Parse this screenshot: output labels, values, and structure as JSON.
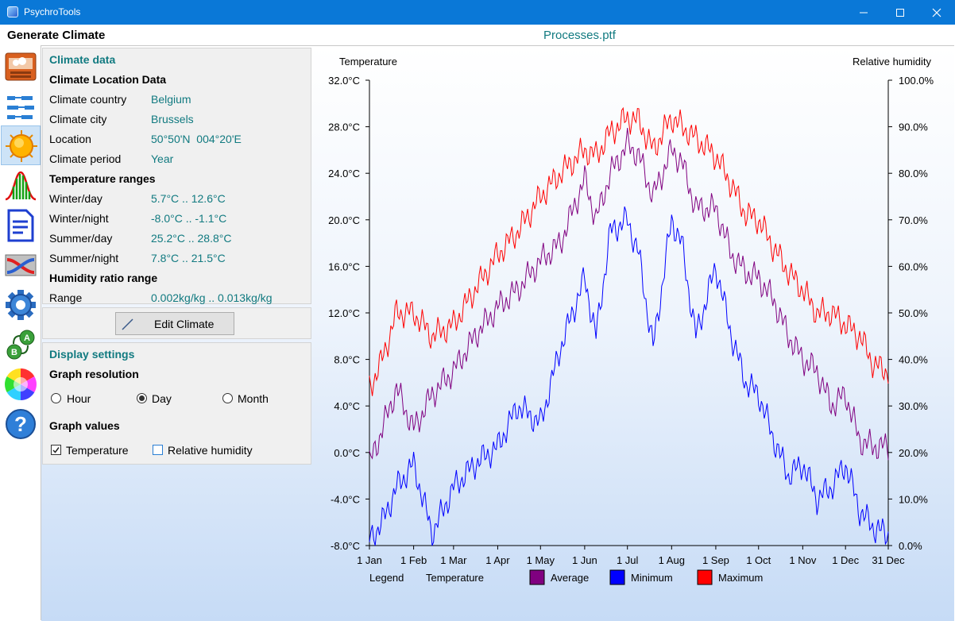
{
  "window": {
    "title": "PsychroTools"
  },
  "header": {
    "page_title": "Generate Climate",
    "file_name": "Processes.ptf"
  },
  "sidebar": {
    "items": [
      {
        "name": "building-icon"
      },
      {
        "name": "process-flow-icon"
      },
      {
        "name": "sun-icon",
        "active": true
      },
      {
        "name": "distribution-icon"
      },
      {
        "name": "document-icon"
      },
      {
        "name": "heat-exchanger-icon"
      },
      {
        "name": "gear-icon"
      },
      {
        "name": "a-b-conversion-icon"
      },
      {
        "name": "color-wheel-icon"
      },
      {
        "name": "help-icon"
      }
    ]
  },
  "climate_data": {
    "title": "Climate data",
    "location_heading": "Climate Location Data",
    "rows": [
      {
        "label": "Climate country",
        "value": "Belgium"
      },
      {
        "label": "Climate city",
        "value": "Brussels"
      },
      {
        "label": "Location",
        "value": "50°50'N  004°20'E"
      },
      {
        "label": "Climate period",
        "value": "Year"
      }
    ],
    "temperature_heading": "Temperature ranges",
    "temp_rows": [
      {
        "label": "Winter/day",
        "value": "5.7°C .. 12.6°C"
      },
      {
        "label": "Winter/night",
        "value": "-8.0°C .. -1.1°C"
      },
      {
        "label": "Summer/day",
        "value": "25.2°C .. 28.8°C"
      },
      {
        "label": "Summer/night",
        "value": "7.8°C .. 21.5°C"
      }
    ],
    "humidity_heading": "Humidity ratio range",
    "humidity_row": {
      "label": "Range",
      "value": "0.002kg/kg .. 0.013kg/kg"
    }
  },
  "edit_button": {
    "label": "Edit Climate"
  },
  "display_settings": {
    "title": "Display settings",
    "resolution_heading": "Graph resolution",
    "resolution_options": [
      "Hour",
      "Day",
      "Month"
    ],
    "resolution_selected": "Day",
    "values_heading": "Graph values",
    "value_options": [
      {
        "label": "Temperature",
        "checked": true
      },
      {
        "label": "Relative humidity",
        "checked": false
      }
    ]
  },
  "chart_data": {
    "type": "line",
    "left_axis_label": "Temperature",
    "right_axis_label": "Relative humidity",
    "ylim": [
      -8,
      32
    ],
    "y_ticks": [
      "32.0°C",
      "28.0°C",
      "24.0°C",
      "20.0°C",
      "16.0°C",
      "12.0°C",
      "8.0°C",
      "4.0°C",
      "0.0°C",
      "-4.0°C",
      "-8.0°C"
    ],
    "y2lim": [
      0,
      100
    ],
    "y2_ticks": [
      "100.0%",
      "90.0%",
      "80.0%",
      "70.0%",
      "60.0%",
      "50.0%",
      "40.0%",
      "30.0%",
      "20.0%",
      "10.0%",
      "0.0%"
    ],
    "x_ticks": [
      {
        "label": "1 Jan",
        "day": 1
      },
      {
        "label": "1 Feb",
        "day": 32
      },
      {
        "label": "1 Mar",
        "day": 60
      },
      {
        "label": "1 Apr",
        "day": 91
      },
      {
        "label": "1 May",
        "day": 121
      },
      {
        "label": "1 Jun",
        "day": 152
      },
      {
        "label": "1 Jul",
        "day": 182
      },
      {
        "label": "1 Aug",
        "day": 213
      },
      {
        "label": "1 Sep",
        "day": 244
      },
      {
        "label": "1 Oct",
        "day": 274
      },
      {
        "label": "1 Nov",
        "day": 305
      },
      {
        "label": "1 Dec",
        "day": 335
      },
      {
        "label": "31 Dec",
        "day": 365
      }
    ],
    "legend": {
      "label": "Legend",
      "group": "Temperature"
    },
    "series": [
      {
        "name": "Average",
        "color": "#800080",
        "days": [
          1,
          10,
          20,
          32,
          45,
          60,
          75,
          91,
          105,
          121,
          135,
          152,
          160,
          170,
          182,
          190,
          200,
          213,
          220,
          230,
          244,
          255,
          265,
          274,
          285,
          295,
          305,
          315,
          325,
          335,
          345,
          355,
          365
        ],
        "values": [
          -1,
          2,
          5.5,
          2,
          5,
          7,
          10,
          12.5,
          14,
          16.5,
          18,
          23.5,
          20,
          24,
          26.5,
          25.5,
          22,
          26,
          25,
          21,
          21,
          17,
          15.5,
          15,
          13,
          10,
          8,
          7,
          4,
          5,
          1,
          0.5,
          0.5
        ]
      },
      {
        "name": "Minimum",
        "color": "#0000ff",
        "days": [
          1,
          10,
          20,
          32,
          45,
          60,
          75,
          91,
          105,
          121,
          135,
          152,
          160,
          170,
          182,
          190,
          200,
          213,
          220,
          230,
          244,
          255,
          265,
          274,
          285,
          295,
          305,
          315,
          325,
          335,
          345,
          355,
          365
        ],
        "values": [
          -7.5,
          -6,
          -3,
          -1,
          -7,
          -3,
          -1,
          0.5,
          4,
          2.5,
          9,
          15,
          10,
          19,
          20,
          17,
          9,
          20,
          18,
          10,
          16,
          10,
          6,
          5,
          1,
          -2,
          -1,
          -4,
          -3,
          -1,
          -5,
          -6.5,
          -7
        ]
      },
      {
        "name": "Maximum",
        "color": "#ff0000",
        "days": [
          1,
          10,
          20,
          32,
          45,
          60,
          75,
          91,
          105,
          121,
          135,
          152,
          160,
          170,
          182,
          190,
          200,
          213,
          220,
          230,
          244,
          255,
          265,
          274,
          285,
          295,
          305,
          315,
          325,
          335,
          345,
          355,
          365
        ],
        "values": [
          5.5,
          8,
          12,
          12,
          10,
          11,
          14,
          17,
          19,
          22,
          24,
          26,
          25.5,
          27.5,
          28.8,
          28.5,
          26,
          28.8,
          28,
          27,
          25.5,
          23,
          20.5,
          20,
          17.5,
          15.5,
          14,
          12,
          12,
          11,
          10,
          7.5,
          7
        ]
      }
    ]
  }
}
